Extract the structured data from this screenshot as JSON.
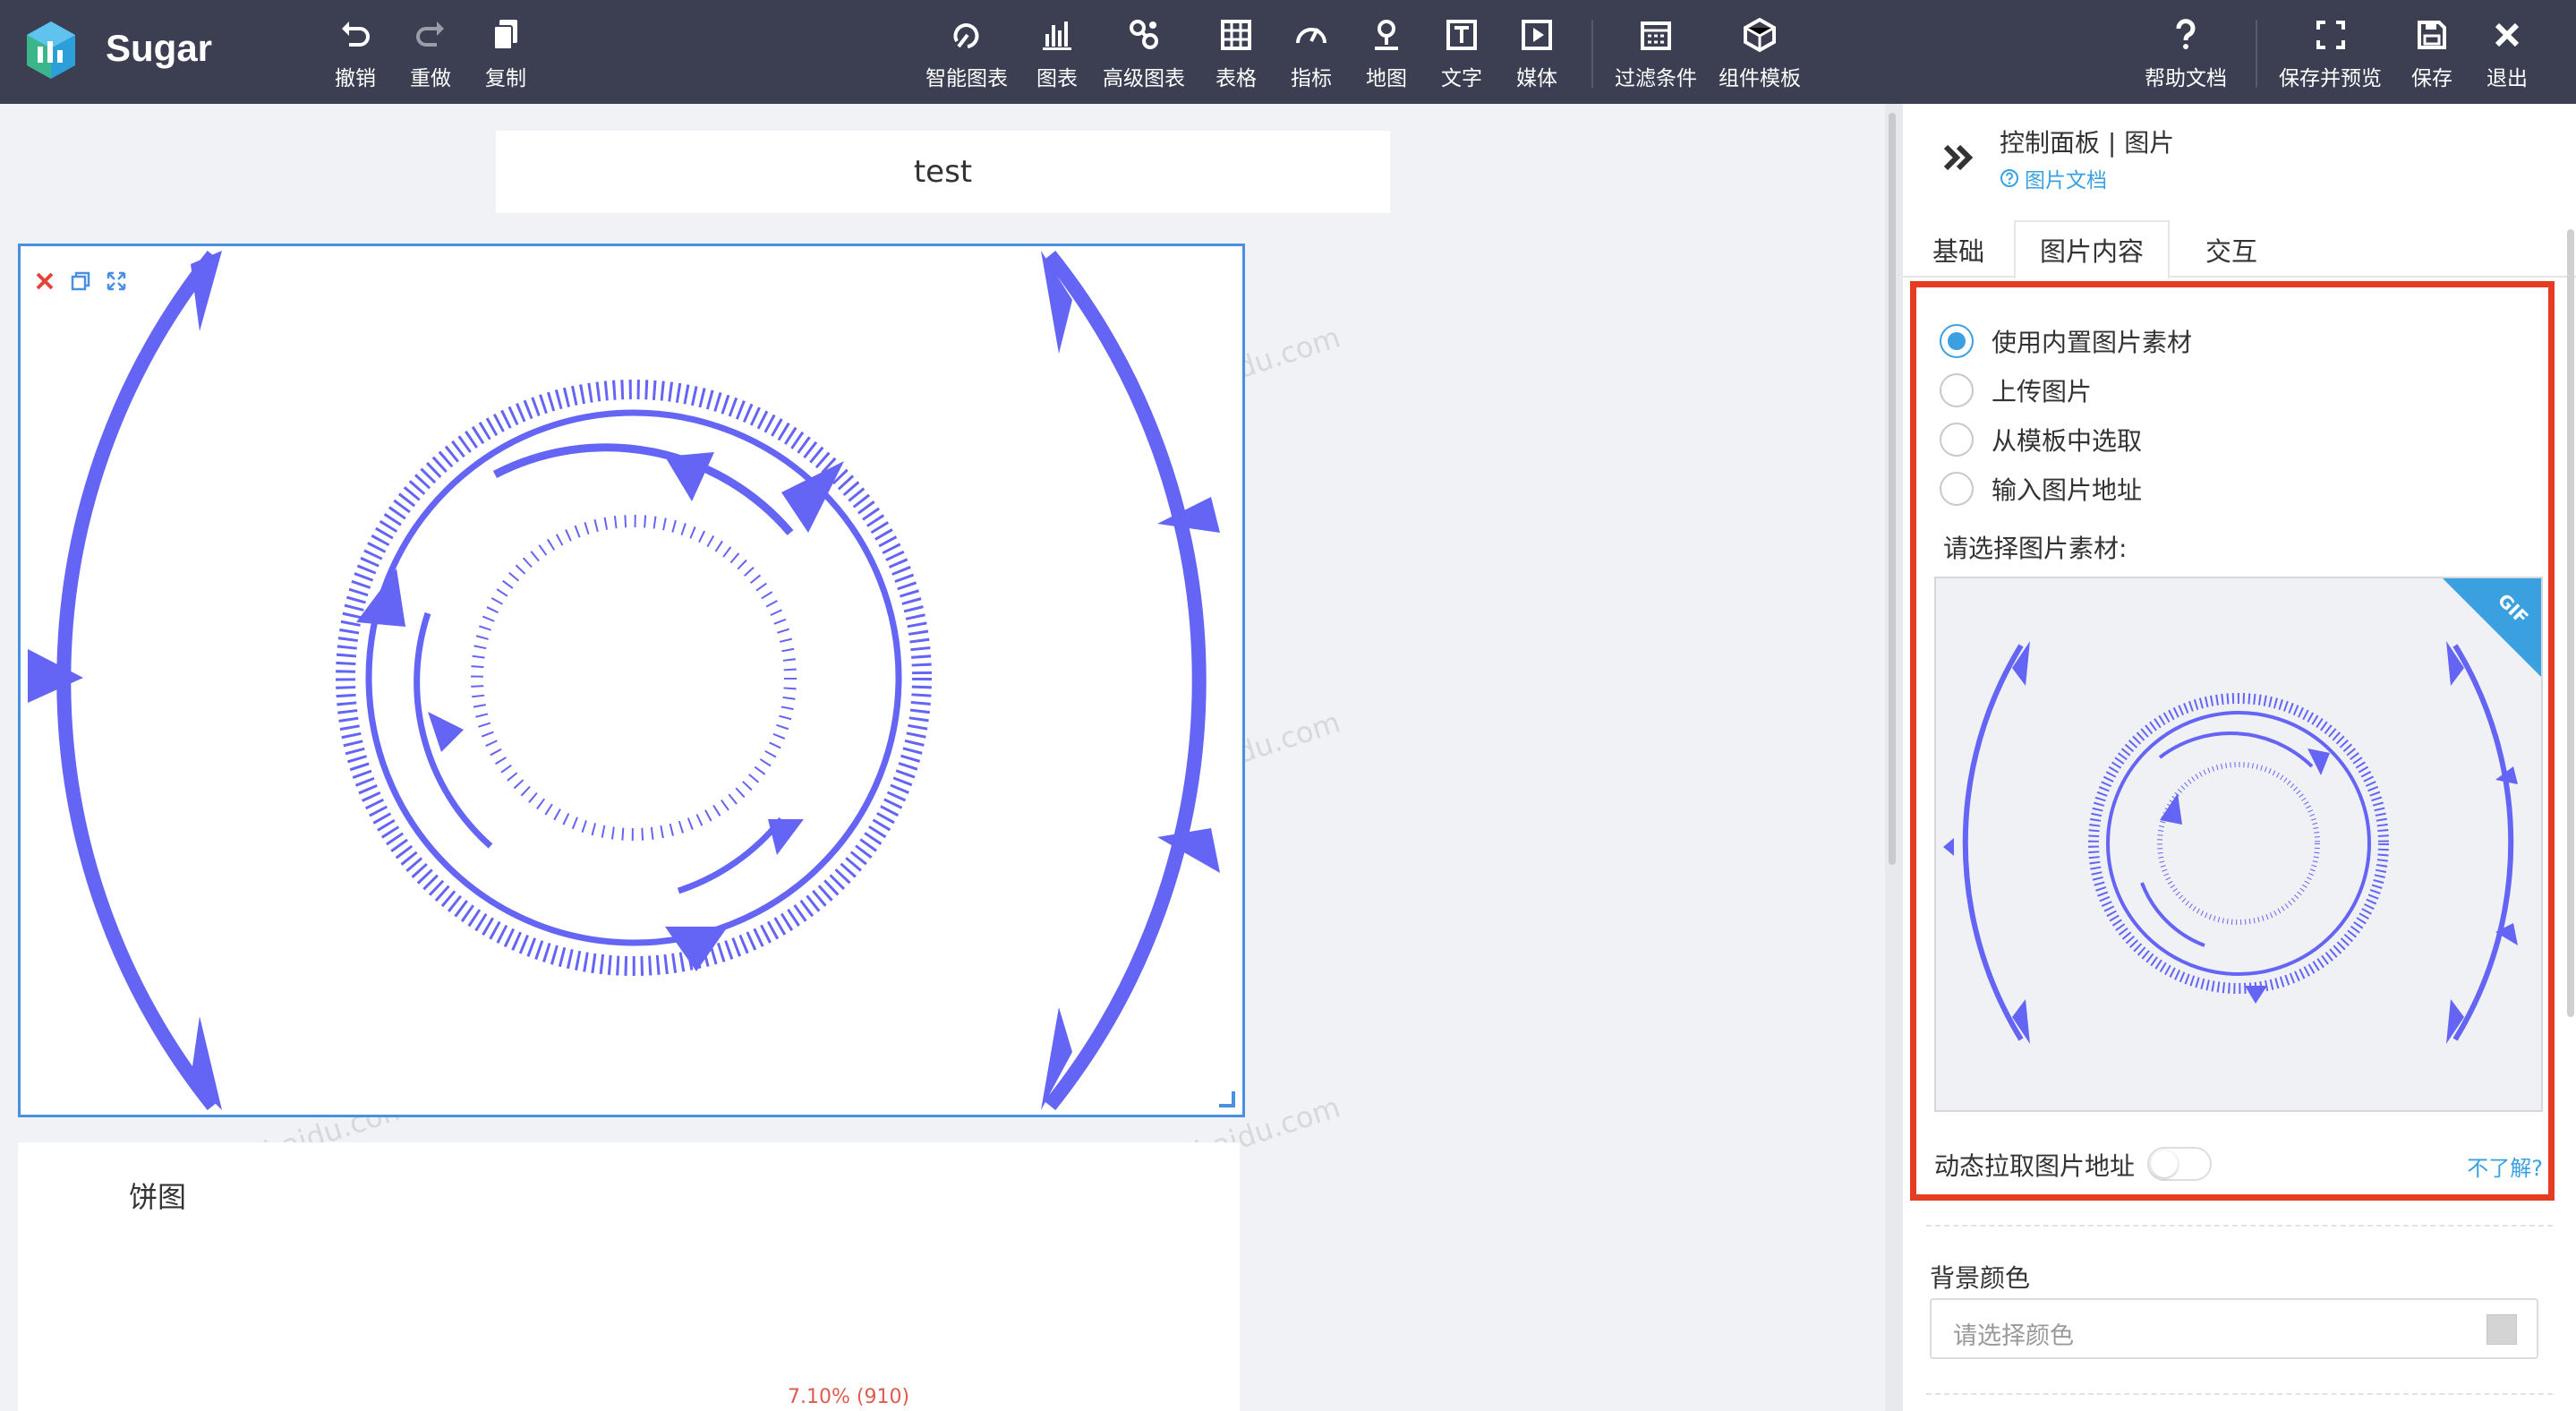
{
  "app": {
    "name": "Sugar"
  },
  "toolbar": {
    "undo": "撤销",
    "redo": "重做",
    "copy": "复制",
    "smart_chart": "智能图表",
    "chart": "图表",
    "advanced_chart": "高级图表",
    "table": "表格",
    "indicator": "指标",
    "map": "地图",
    "text": "文字",
    "media": "媒体",
    "filter": "过滤条件",
    "component_template": "组件模板",
    "help_doc": "帮助文档",
    "save_preview": "保存并预览",
    "save": "保存",
    "exit": "退出"
  },
  "canvas": {
    "title_card_text": "test",
    "pie_card_title": "饼图",
    "pie_partial_label": "7.10% (910)",
    "watermark": "limengzhao@baidu.com"
  },
  "panel": {
    "title": "控制面板 | 图片",
    "doc_link": "图片文档",
    "tabs": [
      "基础",
      "图片内容",
      "交互"
    ],
    "active_tab": "图片内容",
    "radio_options": [
      "使用内置图片素材",
      "上传图片",
      "从模板中选取",
      "输入图片地址"
    ],
    "selected_radio": "使用内置图片素材",
    "select_label": "请选择图片素材:",
    "gif_badge": "GIF",
    "dynamic_label": "动态拉取图片地址",
    "dynamic_enabled": false,
    "help_link": "不了解?",
    "bg_color_label": "背景颜色",
    "bg_color_placeholder": "请选择颜色"
  },
  "colors": {
    "toolbar_bg": "#3b3f51",
    "accent": "#3aa0e0",
    "selection_border": "#4a90e2",
    "highlight_box": "#e73c24",
    "graphic": "#6464f5"
  },
  "icons": {
    "logo": "sugar-logo-icon",
    "collapse": "double-chevron-right-icon",
    "card_close": "close-icon",
    "card_copy": "copy-icon",
    "card_expand": "expand-icon"
  }
}
